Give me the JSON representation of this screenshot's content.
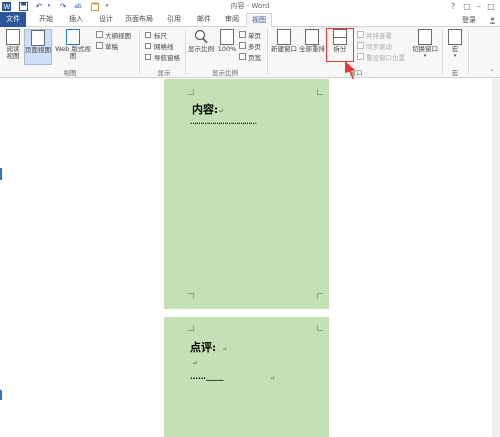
{
  "window": {
    "title": "内容 - Word",
    "sign_in": "登录"
  },
  "quick_access": {
    "undo_label": "↶",
    "redo_label": "↷"
  },
  "tabs": [
    {
      "label": "文件"
    },
    {
      "label": "开始"
    },
    {
      "label": "插入"
    },
    {
      "label": "设计"
    },
    {
      "label": "页面布局"
    },
    {
      "label": "引用"
    },
    {
      "label": "邮件"
    },
    {
      "label": "审阅"
    },
    {
      "label": "视图"
    }
  ],
  "ribbon": {
    "views": {
      "read_mode": "阅读\n视图",
      "print_layout": "页面视图",
      "web_layout": "Web 版式视图",
      "outline": "大纲视图",
      "draft": "草稿",
      "group_label": "视图"
    },
    "show": {
      "ruler": "标尺",
      "gridlines": "网格线",
      "nav_pane": "导航窗格",
      "group_label": "显示"
    },
    "zoom": {
      "zoom": "显示比例",
      "percent": "100%",
      "one_page": "单页",
      "multi_page": "多页",
      "page_width": "页宽",
      "group_label": "显示比例"
    },
    "window": {
      "new_window": "新建窗口",
      "arrange_all": "全部重排",
      "split": "拆分",
      "side_by_side": "并排查看",
      "sync_scroll": "同步滚动",
      "reset_position": "重设窗口位置",
      "switch_windows": "切换窗口",
      "group_label": "窗口"
    },
    "macros": {
      "macros": "宏",
      "group_label": "宏"
    }
  },
  "document": {
    "page1": {
      "heading": "内容:",
      "mark": "↵",
      "dots": "……………………………"
    },
    "page2": {
      "heading": "点评:",
      "mark1": "↵",
      "mark2": "↵",
      "dots": "……",
      "underline": "_____",
      "mark3": "↵"
    }
  },
  "colors": {
    "accent": "#2b579a",
    "page": "#c5e0b4",
    "highlight": "#e53935"
  }
}
